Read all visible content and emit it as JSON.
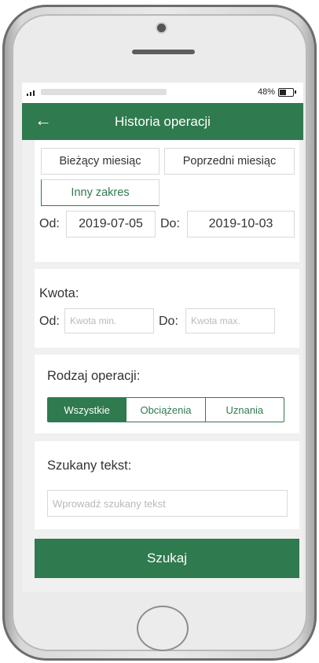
{
  "status_bar": {
    "battery": "48%"
  },
  "header": {
    "title": "Historia operacji",
    "back_icon": "←"
  },
  "date_range": {
    "current_month": "Bieżący miesiąc",
    "previous_month": "Poprzedni miesiąc",
    "other_range": "Inny zakres",
    "from_label": "Od:",
    "from_value": "2019-07-05",
    "to_label": "Do:",
    "to_value": "2019-10-03"
  },
  "amount": {
    "title": "Kwota:",
    "from_label": "Od:",
    "from_placeholder": "Kwota min.",
    "to_label": "Do:",
    "to_placeholder": "Kwota max."
  },
  "operation_type": {
    "title": "Rodzaj operacji:",
    "options": [
      "Wszystkie",
      "Obciążenia",
      "Uznania"
    ],
    "selected": "Wszystkie"
  },
  "search_text": {
    "title": "Szukany tekst:",
    "placeholder": "Wprowadź szukany tekst"
  },
  "search_button": "Szukaj",
  "colors": {
    "accent": "#2f7a4e",
    "background": "#f0f0f0"
  }
}
